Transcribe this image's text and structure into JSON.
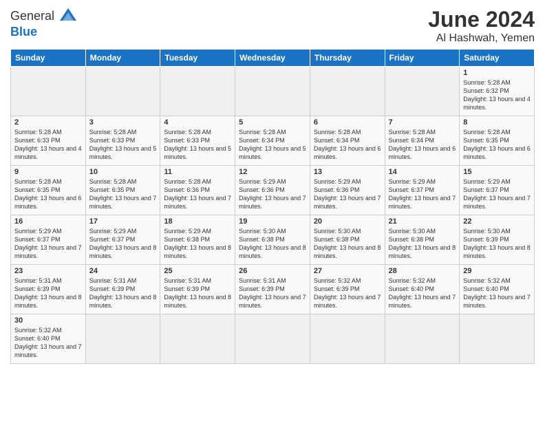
{
  "header": {
    "logo_text1": "General",
    "logo_text2": "Blue",
    "month": "June 2024",
    "location": "Al Hashwah, Yemen"
  },
  "days_of_week": [
    "Sunday",
    "Monday",
    "Tuesday",
    "Wednesday",
    "Thursday",
    "Friday",
    "Saturday"
  ],
  "weeks": [
    [
      {
        "day": "",
        "info": ""
      },
      {
        "day": "",
        "info": ""
      },
      {
        "day": "",
        "info": ""
      },
      {
        "day": "",
        "info": ""
      },
      {
        "day": "",
        "info": ""
      },
      {
        "day": "",
        "info": ""
      },
      {
        "day": "1",
        "info": "Sunrise: 5:28 AM\nSunset: 6:32 PM\nDaylight: 13 hours and 4 minutes."
      }
    ],
    [
      {
        "day": "2",
        "info": "Sunrise: 5:28 AM\nSunset: 6:33 PM\nDaylight: 13 hours and 4 minutes."
      },
      {
        "day": "3",
        "info": "Sunrise: 5:28 AM\nSunset: 6:33 PM\nDaylight: 13 hours and 5 minutes."
      },
      {
        "day": "4",
        "info": "Sunrise: 5:28 AM\nSunset: 6:33 PM\nDaylight: 13 hours and 5 minutes."
      },
      {
        "day": "5",
        "info": "Sunrise: 5:28 AM\nSunset: 6:34 PM\nDaylight: 13 hours and 5 minutes."
      },
      {
        "day": "6",
        "info": "Sunrise: 5:28 AM\nSunset: 6:34 PM\nDaylight: 13 hours and 6 minutes."
      },
      {
        "day": "7",
        "info": "Sunrise: 5:28 AM\nSunset: 6:34 PM\nDaylight: 13 hours and 6 minutes."
      },
      {
        "day": "8",
        "info": "Sunrise: 5:28 AM\nSunset: 6:35 PM\nDaylight: 13 hours and 6 minutes."
      }
    ],
    [
      {
        "day": "9",
        "info": "Sunrise: 5:28 AM\nSunset: 6:35 PM\nDaylight: 13 hours and 6 minutes."
      },
      {
        "day": "10",
        "info": "Sunrise: 5:28 AM\nSunset: 6:35 PM\nDaylight: 13 hours and 7 minutes."
      },
      {
        "day": "11",
        "info": "Sunrise: 5:28 AM\nSunset: 6:36 PM\nDaylight: 13 hours and 7 minutes."
      },
      {
        "day": "12",
        "info": "Sunrise: 5:29 AM\nSunset: 6:36 PM\nDaylight: 13 hours and 7 minutes."
      },
      {
        "day": "13",
        "info": "Sunrise: 5:29 AM\nSunset: 6:36 PM\nDaylight: 13 hours and 7 minutes."
      },
      {
        "day": "14",
        "info": "Sunrise: 5:29 AM\nSunset: 6:37 PM\nDaylight: 13 hours and 7 minutes."
      },
      {
        "day": "15",
        "info": "Sunrise: 5:29 AM\nSunset: 6:37 PM\nDaylight: 13 hours and 7 minutes."
      }
    ],
    [
      {
        "day": "16",
        "info": "Sunrise: 5:29 AM\nSunset: 6:37 PM\nDaylight: 13 hours and 7 minutes."
      },
      {
        "day": "17",
        "info": "Sunrise: 5:29 AM\nSunset: 6:37 PM\nDaylight: 13 hours and 8 minutes."
      },
      {
        "day": "18",
        "info": "Sunrise: 5:29 AM\nSunset: 6:38 PM\nDaylight: 13 hours and 8 minutes."
      },
      {
        "day": "19",
        "info": "Sunrise: 5:30 AM\nSunset: 6:38 PM\nDaylight: 13 hours and 8 minutes."
      },
      {
        "day": "20",
        "info": "Sunrise: 5:30 AM\nSunset: 6:38 PM\nDaylight: 13 hours and 8 minutes."
      },
      {
        "day": "21",
        "info": "Sunrise: 5:30 AM\nSunset: 6:38 PM\nDaylight: 13 hours and 8 minutes."
      },
      {
        "day": "22",
        "info": "Sunrise: 5:30 AM\nSunset: 6:39 PM\nDaylight: 13 hours and 8 minutes."
      }
    ],
    [
      {
        "day": "23",
        "info": "Sunrise: 5:31 AM\nSunset: 6:39 PM\nDaylight: 13 hours and 8 minutes."
      },
      {
        "day": "24",
        "info": "Sunrise: 5:31 AM\nSunset: 6:39 PM\nDaylight: 13 hours and 8 minutes."
      },
      {
        "day": "25",
        "info": "Sunrise: 5:31 AM\nSunset: 6:39 PM\nDaylight: 13 hours and 8 minutes."
      },
      {
        "day": "26",
        "info": "Sunrise: 5:31 AM\nSunset: 6:39 PM\nDaylight: 13 hours and 7 minutes."
      },
      {
        "day": "27",
        "info": "Sunrise: 5:32 AM\nSunset: 6:39 PM\nDaylight: 13 hours and 7 minutes."
      },
      {
        "day": "28",
        "info": "Sunrise: 5:32 AM\nSunset: 6:40 PM\nDaylight: 13 hours and 7 minutes."
      },
      {
        "day": "29",
        "info": "Sunrise: 5:32 AM\nSunset: 6:40 PM\nDaylight: 13 hours and 7 minutes."
      }
    ],
    [
      {
        "day": "30",
        "info": "Sunrise: 5:32 AM\nSunset: 6:40 PM\nDaylight: 13 hours and 7 minutes."
      },
      {
        "day": "",
        "info": ""
      },
      {
        "day": "",
        "info": ""
      },
      {
        "day": "",
        "info": ""
      },
      {
        "day": "",
        "info": ""
      },
      {
        "day": "",
        "info": ""
      },
      {
        "day": "",
        "info": ""
      }
    ]
  ]
}
